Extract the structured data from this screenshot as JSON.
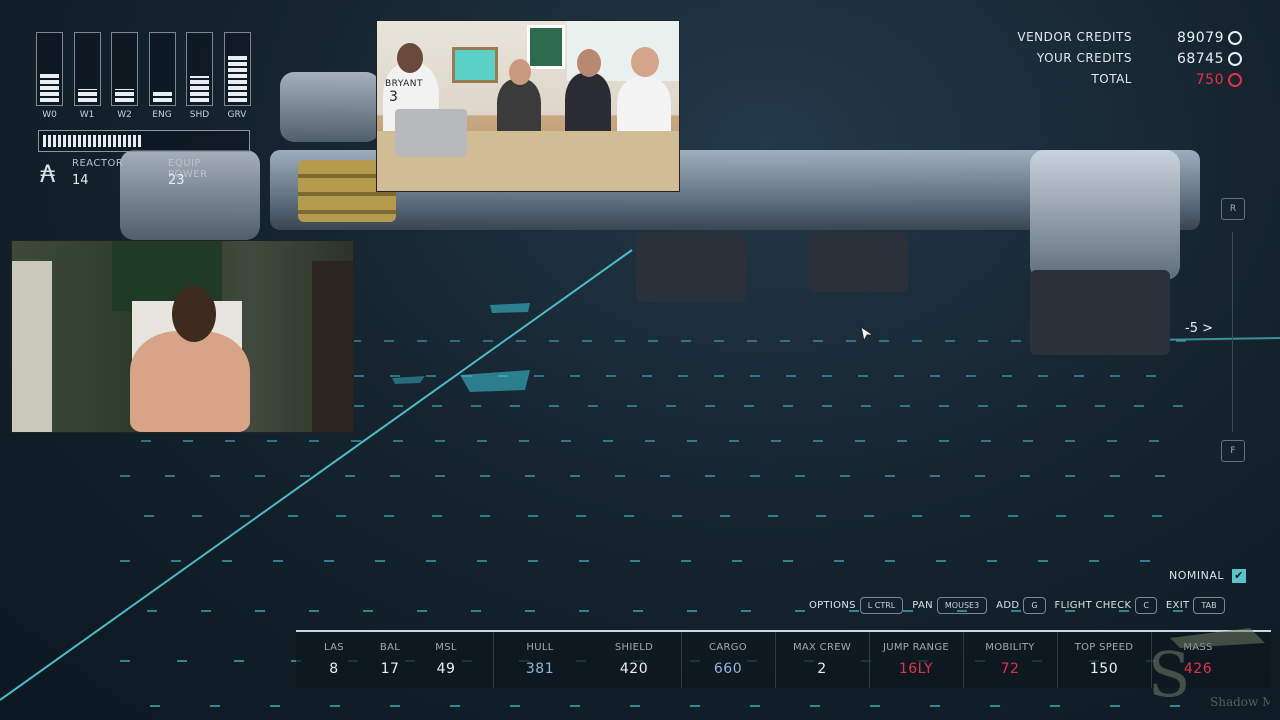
{
  "power": {
    "bars": [
      {
        "label": "W0",
        "level": 0.45
      },
      {
        "label": "W1",
        "level": 0.2
      },
      {
        "label": "W2",
        "level": 0.2
      },
      {
        "label": "ENG",
        "level": 0.15
      },
      {
        "label": "SHD",
        "level": 0.4
      },
      {
        "label": "GRV",
        "level": 0.75
      }
    ],
    "reactor_level": 0.5,
    "reactor_label": "REACTOR",
    "reactor_value": "14",
    "equip_label": "EQUIP POWER",
    "equip_value": "23",
    "reactor_icon": "reactor-icon"
  },
  "credits": {
    "vendor_label": "VENDOR CREDITS",
    "vendor_value": "89079",
    "your_label": "YOUR CREDITS",
    "your_value": "68745",
    "total_label": "TOTAL",
    "total_value": "750",
    "total_color": "#e3314a",
    "currency_icon": "credits-icon"
  },
  "rail": {
    "top_key": "R",
    "bottom_key": "F",
    "marker": "-5 >"
  },
  "status": {
    "label": "NOMINAL",
    "check": "✔"
  },
  "controls": [
    {
      "label": "OPTIONS",
      "key": "L CTRL"
    },
    {
      "label": "PAN",
      "key": "MOUSE3"
    },
    {
      "label": "ADD",
      "key": "G"
    },
    {
      "label": "FLIGHT CHECK",
      "key": "C"
    },
    {
      "label": "EXIT",
      "key": "TAB"
    }
  ],
  "stats": [
    {
      "label": "LAS",
      "value": "8",
      "color": "#e8eef2"
    },
    {
      "label": "BAL",
      "value": "17",
      "color": "#e8eef2"
    },
    {
      "label": "MSL",
      "value": "49",
      "color": "#e8eef2"
    },
    {
      "label": "HULL",
      "value": "381",
      "color": "#8fb6d8"
    },
    {
      "label": "SHIELD",
      "value": "420",
      "color": "#e8eef2"
    },
    {
      "label": "CARGO",
      "value": "660",
      "color": "#8fb6d8"
    },
    {
      "label": "MAX CREW",
      "value": "2",
      "color": "#e8eef2"
    },
    {
      "label": "JUMP RANGE",
      "value": "16LY",
      "color": "#e3314a"
    },
    {
      "label": "MOBILITY",
      "value": "72",
      "color": "#e3314a"
    },
    {
      "label": "TOP SPEED",
      "value": "150",
      "color": "#e8eef2"
    },
    {
      "label": "MASS",
      "value": "426",
      "color": "#e3314a"
    }
  ],
  "podcast_overlay": {
    "jersey_text": "BRYANT",
    "jersey_number": "3"
  },
  "watermark": {
    "text": "Shadow Monk"
  },
  "colors": {
    "accent": "#59c3c9",
    "warning": "#e3314a"
  }
}
